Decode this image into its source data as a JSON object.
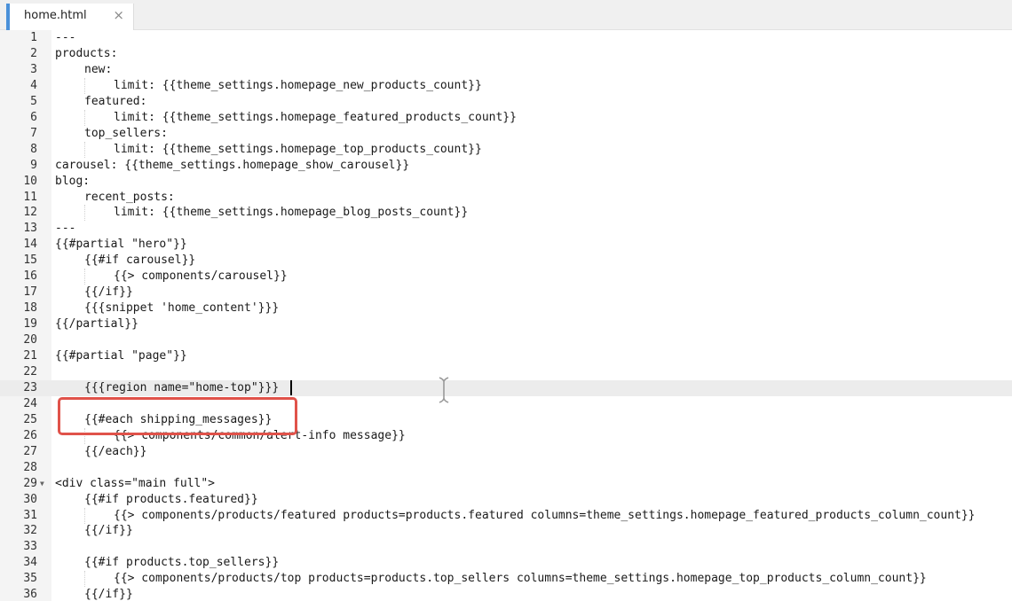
{
  "tab": {
    "filename": "home.html",
    "close_glyph": "×"
  },
  "editor": {
    "current_line": 23,
    "highlight_color": "#e0524a",
    "lines": [
      {
        "n": "1",
        "text": "---"
      },
      {
        "n": "2",
        "text": "products:"
      },
      {
        "n": "3",
        "text": "new:"
      },
      {
        "n": "4",
        "text": "limit: {{theme_settings.homepage_new_products_count}}"
      },
      {
        "n": "5",
        "text": "featured:"
      },
      {
        "n": "6",
        "text": "limit: {{theme_settings.homepage_featured_products_count}}"
      },
      {
        "n": "7",
        "text": "top_sellers:"
      },
      {
        "n": "8",
        "text": "limit: {{theme_settings.homepage_top_products_count}}"
      },
      {
        "n": "9",
        "text": "carousel: {{theme_settings.homepage_show_carousel}}"
      },
      {
        "n": "10",
        "text": "blog:"
      },
      {
        "n": "11",
        "text": "recent_posts:"
      },
      {
        "n": "12",
        "text": "limit: {{theme_settings.homepage_blog_posts_count}}"
      },
      {
        "n": "13",
        "text": "---"
      },
      {
        "n": "14",
        "text": "{{#partial \"hero\"}}"
      },
      {
        "n": "15",
        "text": "{{#if carousel}}"
      },
      {
        "n": "16",
        "text": "{{> components/carousel}}"
      },
      {
        "n": "17",
        "text": "{{/if}}"
      },
      {
        "n": "18",
        "text": "{{{snippet 'home_content'}}}"
      },
      {
        "n": "19",
        "text": "{{/partial}}"
      },
      {
        "n": "20",
        "text": ""
      },
      {
        "n": "21",
        "text": "{{#partial \"page\"}}"
      },
      {
        "n": "22",
        "text": ""
      },
      {
        "n": "23",
        "text": "{{{region name=\"home-top\"}}}"
      },
      {
        "n": "24",
        "text": ""
      },
      {
        "n": "25",
        "text": "{{#each shipping_messages}}"
      },
      {
        "n": "26",
        "text": "{{> components/common/alert-info message}}"
      },
      {
        "n": "27",
        "text": "{{/each}}"
      },
      {
        "n": "28",
        "text": ""
      },
      {
        "n": "29",
        "text": "<div class=\"main full\">"
      },
      {
        "n": "30",
        "text": "{{#if products.featured}}"
      },
      {
        "n": "31",
        "text": "{{> components/products/featured products=products.featured columns=theme_settings.homepage_featured_products_column_count}}"
      },
      {
        "n": "32",
        "text": "{{/if}}"
      },
      {
        "n": "33",
        "text": ""
      },
      {
        "n": "34",
        "text": "{{#if products.top_sellers}}"
      },
      {
        "n": "35",
        "text": "{{> components/products/top products=products.top_sellers columns=theme_settings.homepage_top_products_column_count}}"
      },
      {
        "n": "36",
        "text": "{{/if}}"
      }
    ]
  }
}
